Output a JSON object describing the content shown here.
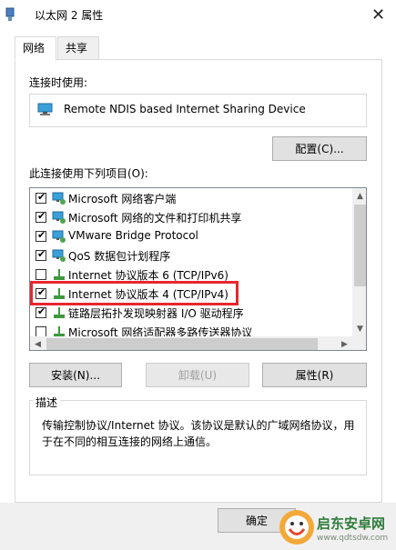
{
  "window": {
    "title": "以太网 2 属性",
    "close_glyph": "✕"
  },
  "tabs": [
    {
      "label": "网络"
    },
    {
      "label": "共享"
    }
  ],
  "connect_using": {
    "label": "连接时使用:",
    "device_name": "Remote NDIS based Internet Sharing Device",
    "configure_button": "配置(C)..."
  },
  "components": {
    "label": "此连接使用下列项目(O):",
    "items": [
      {
        "label": "Microsoft 网络客户端",
        "checked": true,
        "icon": "network-client-icon"
      },
      {
        "label": "Microsoft 网络的文件和打印机共享",
        "checked": true,
        "icon": "network-service-icon"
      },
      {
        "label": "VMware Bridge Protocol",
        "checked": true,
        "icon": "network-service-icon"
      },
      {
        "label": "QoS 数据包计划程序",
        "checked": true,
        "icon": "network-service-icon"
      },
      {
        "label": "Internet 协议版本 6 (TCP/IPv6)",
        "checked": false,
        "icon": "protocol-icon"
      },
      {
        "label": "Internet 协议版本 4 (TCP/IPv4)",
        "checked": true,
        "icon": "protocol-icon"
      },
      {
        "label": "链路层拓扑发现映射器 I/O 驱动程序",
        "checked": true,
        "icon": "protocol-icon"
      },
      {
        "label": "Microsoft 网络适配器多路传送器协议",
        "checked": false,
        "icon": "protocol-icon"
      }
    ],
    "check_glyph": "✔"
  },
  "actions": {
    "install": "安装(N)...",
    "uninstall": "卸载(U)",
    "properties": "属性(R)"
  },
  "description": {
    "title": "描述",
    "text": "传输控制协议/Internet 协议。该协议是默认的广域网络协议，用于在不同的相互连接的网络上通信。"
  },
  "footer": {
    "ok": "确定"
  },
  "watermark": {
    "text": "启东安卓网",
    "url": "www.qdtsdw.com"
  },
  "colors": {
    "highlight_border": "#e8262d",
    "watermark_green": "#2f7b3b"
  }
}
